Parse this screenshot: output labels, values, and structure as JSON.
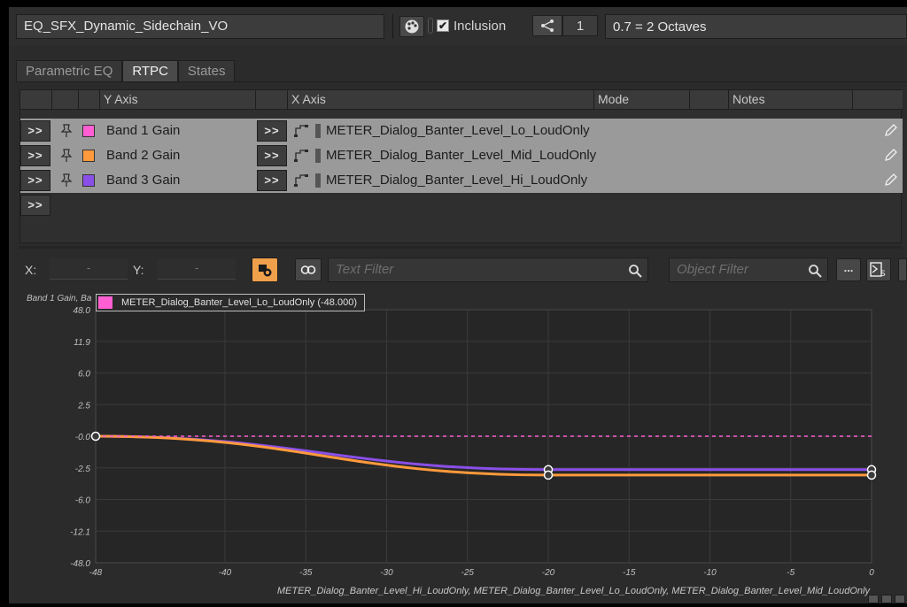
{
  "header": {
    "object_name": "EQ_SFX_Dynamic_Sidechain_VO",
    "inclusion_label": "Inclusion",
    "inclusion_checked": "✔",
    "share_count": "1",
    "octave_value": "0.7 = 2 Octaves"
  },
  "tabs": [
    {
      "label": "Parametric EQ",
      "active": false
    },
    {
      "label": "RTPC",
      "active": true
    },
    {
      "label": "States",
      "active": false
    }
  ],
  "table": {
    "columns": [
      "Y Axis",
      "X Axis",
      "Mode",
      "Notes"
    ],
    "expand_label": ">>",
    "rows": [
      {
        "y_axis": "Band 1 Gain",
        "x_axis": "METER_Dialog_Banter_Level_Lo_LoudOnly",
        "color": "#ff5fd2"
      },
      {
        "y_axis": "Band 2 Gain",
        "x_axis": "METER_Dialog_Banter_Level_Mid_LoudOnly",
        "color": "#ff9a3c"
      },
      {
        "y_axis": "Band 3 Gain",
        "x_axis": "METER_Dialog_Banter_Level_Hi_LoudOnly",
        "color": "#8a4fe8"
      }
    ]
  },
  "graph_toolbar": {
    "x_label": "X:",
    "y_label": "Y:",
    "x_value": "-",
    "y_value": "-",
    "text_filter_placeholder": "Text Filter",
    "object_filter_placeholder": "Object Filter",
    "more_label": "..."
  },
  "graph": {
    "y_axis_title": "Band 1 Gain, Ba",
    "tooltip": "METER_Dialog_Banter_Level_Lo_LoudOnly  (-48.000)",
    "tooltip_color": "#ff5fd2",
    "x_axis_title": "METER_Dialog_Banter_Level_Hi_LoudOnly,  METER_Dialog_Banter_Level_Lo_LoudOnly,  METER_Dialog_Banter_Level_Mid_LoudOnly"
  },
  "chart_data": {
    "type": "line",
    "x_ticks": [
      "-48",
      "-40",
      "-35",
      "-30",
      "-25",
      "-20",
      "-15",
      "-10",
      "-5",
      "0"
    ],
    "x_tick_values": [
      -48,
      -40,
      -35,
      -30,
      -25,
      -20,
      -15,
      -10,
      -5,
      0
    ],
    "y_ticks": [
      "48.0",
      "11.9",
      "6.0",
      "2.5",
      "-0.0",
      "-2.5",
      "-6.0",
      "-12.1",
      "-48.0"
    ],
    "xlim": [
      -48,
      0
    ],
    "grid": true,
    "series": [
      {
        "color": "#8a4fe8",
        "x": [
          -48,
          -20,
          0
        ],
        "y": [
          0.0,
          -2.7,
          -2.7
        ]
      },
      {
        "color": "#ff9a3c",
        "x": [
          -48,
          -20,
          0
        ],
        "y": [
          0.0,
          -3.3,
          -3.3
        ]
      },
      {
        "color": "#ff5fd2",
        "x": [
          -48,
          0
        ],
        "y": [
          0.0,
          0.0
        ],
        "dashed": true
      }
    ]
  }
}
